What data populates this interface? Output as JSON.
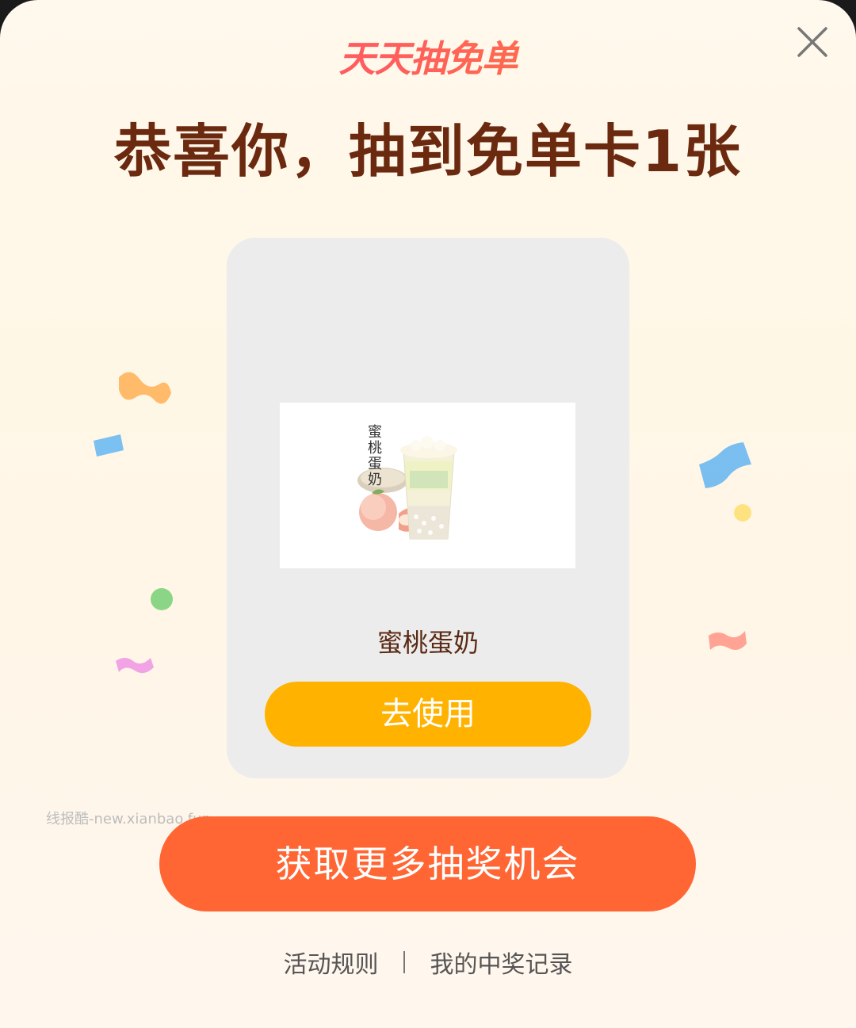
{
  "modal": {
    "brand_logo_text": "天天抽免单",
    "headline": "恭喜你，抽到免单卡1张",
    "close_icon": "close-icon"
  },
  "prize_card": {
    "image_text": "蜜桃蛋奶",
    "name": "蜜桃蛋奶",
    "use_button_label": "去使用"
  },
  "watermark": "线报酷-new.xianbao.fun",
  "more_chances_label": "获取更多抽奖机会",
  "footer": {
    "rules_label": "活动规则",
    "separator": "|",
    "records_label": "我的中奖记录"
  },
  "colors": {
    "headline": "#6b2a10",
    "use_button": "#ffb200",
    "more_button": "#ff6634",
    "card_bg": "#ececec"
  }
}
